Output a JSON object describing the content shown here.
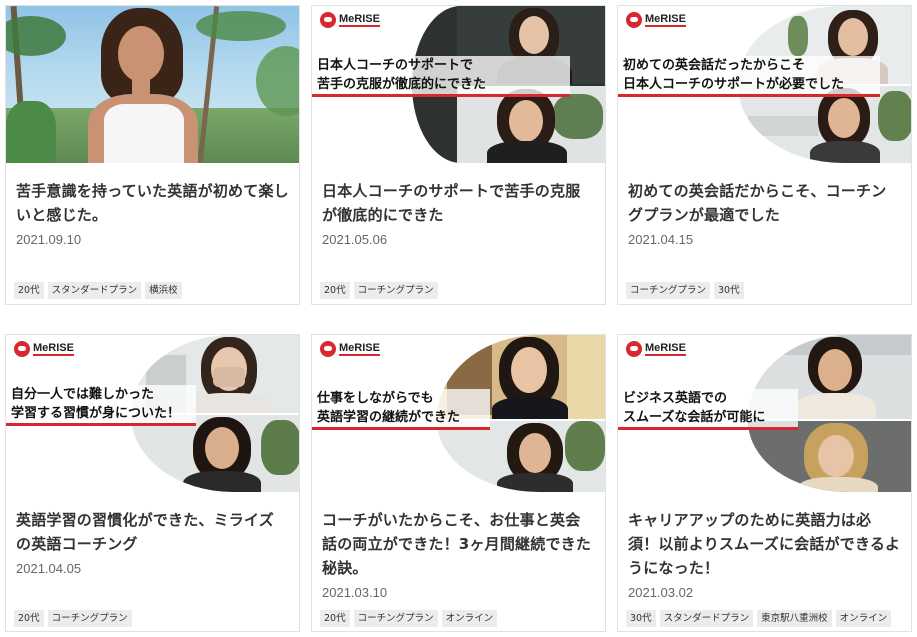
{
  "brand": {
    "logo_text": "MeRISE",
    "accent": "#d7282f"
  },
  "cards": [
    {
      "title": "苦手意識を持っていた英語が初めて楽しいと感じた。",
      "date": "2021.09.10",
      "tags": [
        "20代",
        "スタンダードプラン",
        "横浜校"
      ],
      "image": "photo-woman-beach"
    },
    {
      "title": "日本人コーチのサポートで苦手の克服が徹底的にできた",
      "date": "2021.05.06",
      "tags": [
        "20代",
        "コーチングプラン"
      ],
      "caption": [
        "日本人コーチのサポートで",
        "苦手の克服が徹底的にできた"
      ]
    },
    {
      "title": "初めての英会話だからこそ、コーチングプランが最適でした",
      "date": "2021.04.15",
      "tags": [
        "コーチングプラン",
        "30代"
      ],
      "caption": [
        "初めての英会話だったからこそ",
        "日本人コーチのサポートが必要でした"
      ]
    },
    {
      "title": "英語学習の習慣化ができた、ミライズの英語コーチング",
      "date": "2021.04.05",
      "tags": [
        "20代",
        "コーチングプラン"
      ],
      "caption": [
        "自分一人では難しかった",
        "学習する習慣が身についた！"
      ]
    },
    {
      "title": "コーチがいたからこそ、お仕事と英会話の両立ができた！3ヶ月間継続できた秘訣。",
      "date": "2021.03.10",
      "tags": [
        "20代",
        "コーチングプラン",
        "オンライン"
      ],
      "caption": [
        "仕事をしながらでも",
        "英語学習の継続ができた"
      ]
    },
    {
      "title": "キャリアアップのために英語力は必須！以前よりスムーズに会話ができるようになった！",
      "date": "2021.03.02",
      "tags": [
        "30代",
        "スタンダードプラン",
        "東京駅八重洲校",
        "オンライン"
      ],
      "caption": [
        "ビジネス英語での",
        "スムーズな会話が可能に"
      ]
    }
  ]
}
